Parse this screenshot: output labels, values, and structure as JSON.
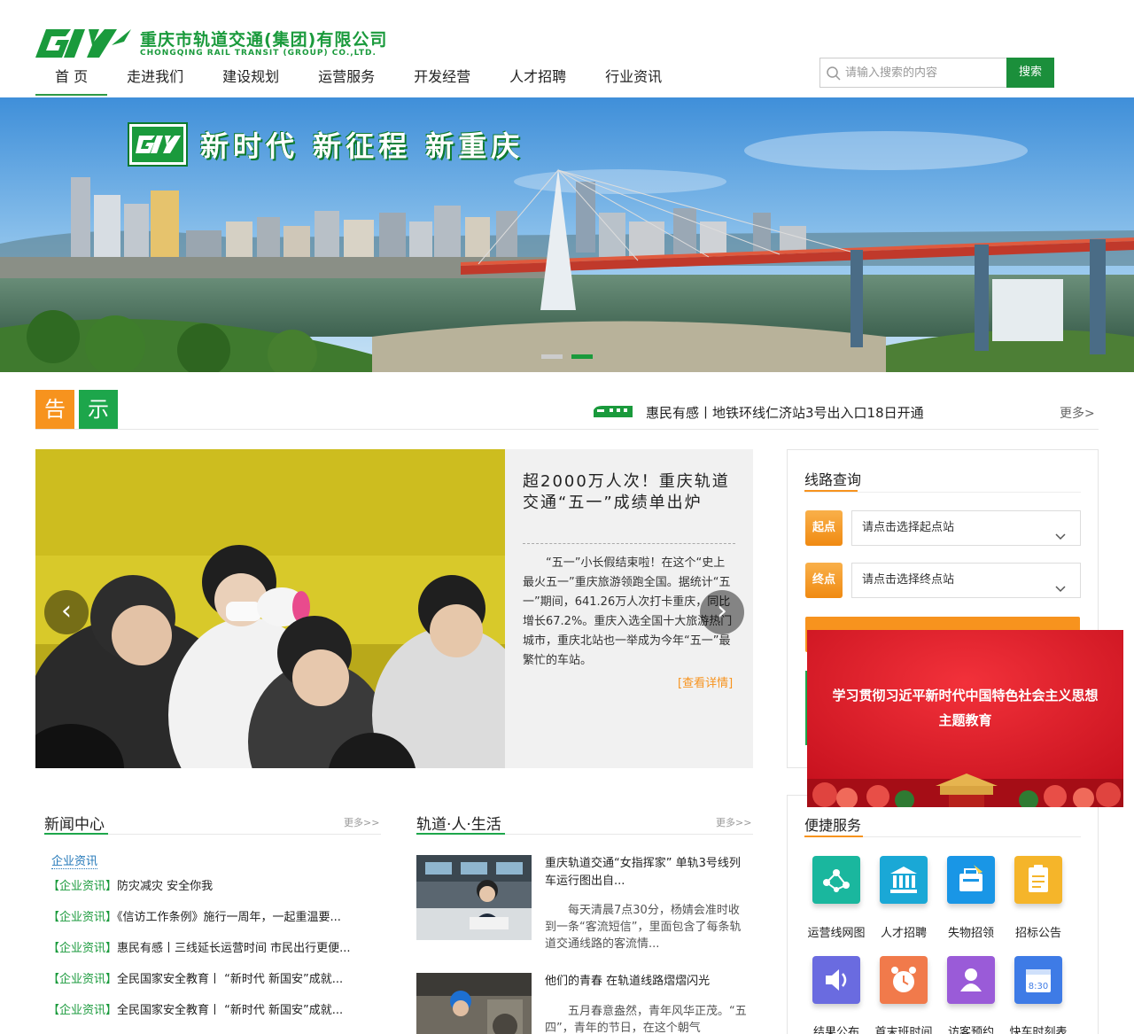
{
  "header": {
    "logo_cn": "重庆市轨道交通(集团)有限公司",
    "logo_en": "CHONGQING RAIL TRANSIT (GROUP) CO.,LTD.",
    "nav": [
      {
        "label": "首 页"
      },
      {
        "label": "走进我们"
      },
      {
        "label": "建设规划"
      },
      {
        "label": "运营服务"
      },
      {
        "label": "开发经营"
      },
      {
        "label": "人才招聘"
      },
      {
        "label": "行业资讯"
      }
    ],
    "active_nav": "首 页",
    "search_placeholder": "请输入搜索的内容",
    "search_button": "搜索"
  },
  "banner": {
    "slogan": "新时代 新征程 新重庆",
    "slides": 2,
    "active_slide": 2
  },
  "notice": {
    "label_1": "告",
    "label_2": "示",
    "text": "惠民有感丨地铁环线仁济站3号出入口18日开通",
    "more": "更多>"
  },
  "featured": {
    "title": "超2000万人次！重庆轨道交通“五一”成绩单出炉",
    "body": "“五一”小长假结束啦！在这个“史上最火五一”重庆旅游领跑全国。据统计“五一”期间，641.26万人次打卡重庆，同比增长67.2%。重庆入选全国十大旅游热门城市，重庆北站也一举成为今年“五一”最繁忙的车站。",
    "link": "[查看详情]",
    "prev": "‹",
    "next": "›"
  },
  "route": {
    "title": "线路查询",
    "start_tag": "起点",
    "end_tag": "终点",
    "start_placeholder": "请点击选择起点站",
    "end_placeholder": "请点击选择终点站"
  },
  "popup": {
    "line1": "学习贯彻习近平新时代中国特色社会主义思想",
    "line2": "主题教育"
  },
  "news": {
    "title": "新闻中心",
    "more": "更多>>",
    "tab": "企业资讯",
    "items": [
      {
        "cat": "【企业资讯】",
        "text": "防灾减灾 安全你我"
      },
      {
        "cat": "【企业资讯】",
        "text": "《信访工作条例》施行一周年，一起重温要..."
      },
      {
        "cat": "【企业资讯】",
        "text": "惠民有感丨三线延长运营时间 市民出行更便..."
      },
      {
        "cat": "【企业资讯】",
        "text": "全民国家安全教育丨 “新时代 新国安”成就..."
      },
      {
        "cat": "【企业资讯】",
        "text": "全民国家安全教育丨 “新时代 新国安”成就..."
      }
    ]
  },
  "life": {
    "title": "轨道·人·生活",
    "more": "更多>>",
    "items": [
      {
        "title": "重庆轨道交通“女指挥家” 单轨3号线列车运行图出自...",
        "body": "每天清晨7点30分，杨婧会准时收到一条“客流短信”，里面包含了每条轨道交通线路的客流情..."
      },
      {
        "title": "他们的青春 在轨道线路熠熠闪光",
        "body": "五月春意盎然，青年风华正茂。“五四”，青年的节日，在这个朝气"
      }
    ]
  },
  "services": {
    "title": "便捷服务",
    "items": [
      {
        "label": "运营线网图",
        "icon": "network-icon",
        "color": "#1ab79e"
      },
      {
        "label": "人才招聘",
        "icon": "building-icon",
        "color": "#1aa8d6"
      },
      {
        "label": "失物招领",
        "icon": "lost-found-icon",
        "color": "#1996e6"
      },
      {
        "label": "招标公告",
        "icon": "clipboard-icon",
        "color": "#f5b52a"
      },
      {
        "label": "结果公布",
        "icon": "speaker-icon",
        "color": "#6a6be0"
      },
      {
        "label": "首末班时间",
        "icon": "alarm-clock-icon",
        "color": "#f17a4b"
      },
      {
        "label": "访客预约",
        "icon": "visitor-icon",
        "color": "#9a5bd8"
      },
      {
        "label": "快车时刻表",
        "icon": "calendar-icon",
        "color": "#3e7be6"
      }
    ]
  }
}
